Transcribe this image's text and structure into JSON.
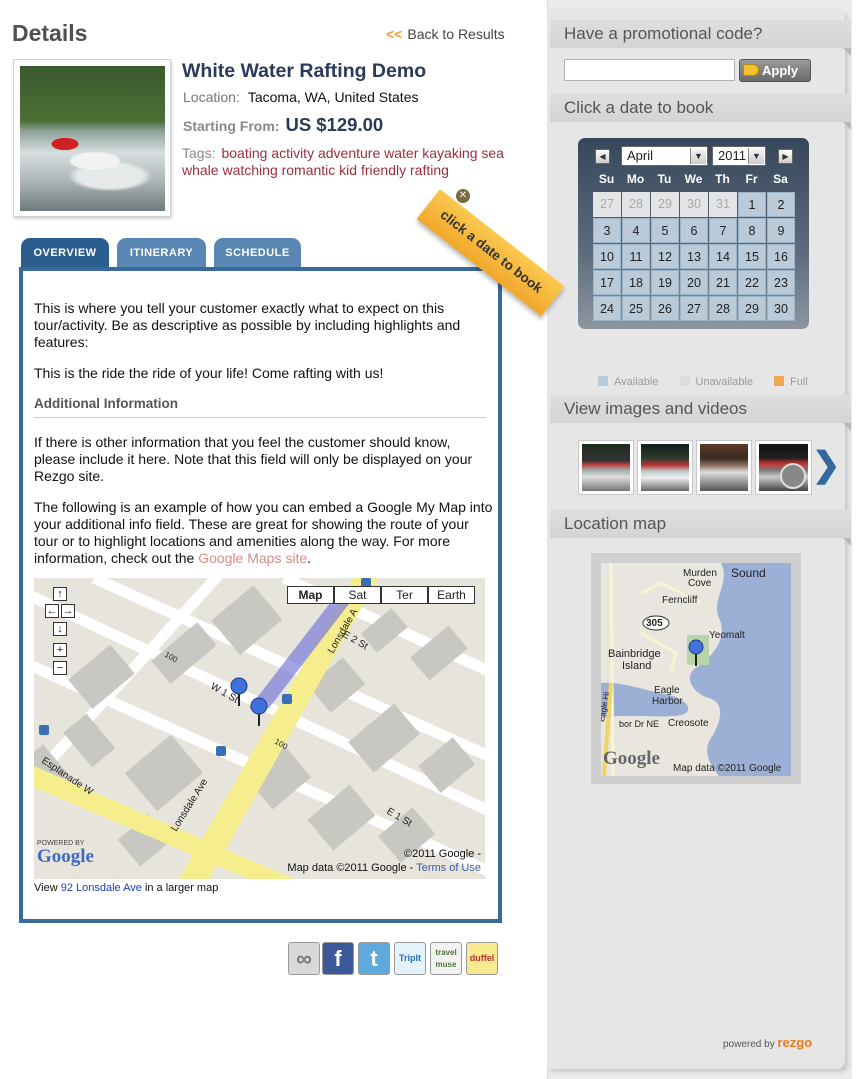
{
  "header": {
    "title": "Details",
    "back_arrows": "<<",
    "back_label": "Back to Results"
  },
  "tour": {
    "title": "White Water Rafting Demo",
    "location_label": "Location:",
    "location": "Tacoma, WA, United States",
    "price_label": "Starting From:",
    "price": "US $129.00",
    "tags_label": "Tags:",
    "tags": "boating activity adventure water kayaking sea whale watching romantic kid friendly rafting"
  },
  "tabs": [
    {
      "label": "OVERVIEW",
      "active": true
    },
    {
      "label": "ITINERARY",
      "active": false
    },
    {
      "label": "SCHEDULE",
      "active": false
    }
  ],
  "overview": {
    "p1": "This is where you tell your customer exactly what to expect on this tour/activity. Be as descriptive as possible by including highlights and features:",
    "p2": "This is the ride the ride of your life! Come rafting with us!",
    "additional_heading": "Additional Information",
    "p3": "If there is other information that you feel the customer should know, please include it here. Note that this field will only be displayed on your Rezgo site.",
    "p4": "The following is an example of how you can embed a Google My Map into your additional info field.  These are great for showing the route of your tour or to highlight locations and amenities along the way.  For more information, check out the",
    "p4_link": "Google Maps site",
    "p4_end": "."
  },
  "embed_map": {
    "types": [
      "Map",
      "Sat",
      "Ter",
      "Earth"
    ],
    "nav_glyphs": {
      "up": "↑",
      "left": "←",
      "right": "→",
      "down": "↓",
      "zoom_in": "+",
      "zoom_out": "−"
    },
    "streets": {
      "lonsdale_top": "Lonsdale A",
      "e2": "E 2 St",
      "w1": "W 1 St",
      "esplanade": "Esplanade W",
      "lonsdale_bottom": "Lonsdale Ave",
      "e1": "E 1 St",
      "hundred_a": "100",
      "hundred_b": "100"
    },
    "powered_by": "POWERED BY",
    "logo": "Google",
    "copyright1": "©2011 Google -",
    "copyright2": "Map data ©2011 Google -",
    "terms": "Terms of Use",
    "view_prefix": "View",
    "view_link": "92 Lonsdale Ave",
    "view_suffix": "in a larger map"
  },
  "social": [
    {
      "name": "link",
      "glyph": "∞",
      "bg": "#d8d8d8",
      "fg": "#777"
    },
    {
      "name": "facebook",
      "glyph": "f",
      "bg": "#3b5998",
      "fg": "#ffffff"
    },
    {
      "name": "twitter",
      "glyph": "t",
      "bg": "#5ea9dd",
      "fg": "#ffffff"
    },
    {
      "name": "tripit",
      "glyph": "TripIt",
      "bg": "#e4f2fb",
      "fg": "#2a70b8"
    },
    {
      "name": "travelmuse",
      "glyph": "travel muse",
      "bg": "#f2f2f2",
      "fg": "#4a7a32"
    },
    {
      "name": "duffel",
      "glyph": "duffel",
      "bg": "#f7e98f",
      "fg": "#b8332a"
    }
  ],
  "sidebar": {
    "promo_heading": "Have a promotional code?",
    "promo_value": "",
    "apply_label": "Apply",
    "book_heading": "Click a date to book",
    "ribbon": "click a date to book",
    "ribbon_close": "✕",
    "calendar": {
      "month": "April",
      "year": "2011",
      "prev_glyph": "◀",
      "next_glyph": "▶",
      "select_glyph": "▼",
      "weekdays": [
        "Su",
        "Mo",
        "Tu",
        "We",
        "Th",
        "Fr",
        "Sa"
      ],
      "weeks": [
        [
          [
            "27",
            "out"
          ],
          [
            "28",
            "out"
          ],
          [
            "29",
            "out"
          ],
          [
            "30",
            "out"
          ],
          [
            "31",
            "out"
          ],
          [
            "1",
            "avail"
          ],
          [
            "2",
            "avail"
          ]
        ],
        [
          [
            "3",
            "avail"
          ],
          [
            "4",
            "avail"
          ],
          [
            "5",
            "avail"
          ],
          [
            "6",
            "avail"
          ],
          [
            "7",
            "avail"
          ],
          [
            "8",
            "avail"
          ],
          [
            "9",
            "avail"
          ]
        ],
        [
          [
            "10",
            "avail"
          ],
          [
            "11",
            "avail"
          ],
          [
            "12",
            "avail"
          ],
          [
            "13",
            "avail"
          ],
          [
            "14",
            "avail"
          ],
          [
            "15",
            "avail"
          ],
          [
            "16",
            "avail"
          ]
        ],
        [
          [
            "17",
            "avail"
          ],
          [
            "18",
            "avail"
          ],
          [
            "19",
            "avail"
          ],
          [
            "20",
            "avail"
          ],
          [
            "21",
            "avail"
          ],
          [
            "22",
            "avail"
          ],
          [
            "23",
            "avail"
          ]
        ],
        [
          [
            "24",
            "avail"
          ],
          [
            "25",
            "avail"
          ],
          [
            "26",
            "avail"
          ],
          [
            "27",
            "avail"
          ],
          [
            "28",
            "avail"
          ],
          [
            "29",
            "avail"
          ],
          [
            "30",
            "avail"
          ]
        ]
      ]
    },
    "legend": [
      {
        "label": "Available",
        "color": "#b9cad8"
      },
      {
        "label": "Unavailable",
        "color": "#dcdcdc"
      },
      {
        "label": "Full",
        "color": "#f0a850"
      }
    ],
    "media_heading": "View images and videos",
    "media_next": "❯",
    "map_heading": "Location map",
    "location_map": {
      "labels": {
        "murden": "Murden",
        "cove": "Cove",
        "sound": "Sound",
        "ferncliff": "Ferncliff",
        "route": "305",
        "yeomalt": "Yeomalt",
        "bainbridge": "Bainbridge",
        "island": "Island",
        "eagle": "Eagle",
        "harbor": "Harbor",
        "ne": "bor Dr NE",
        "creosote": "Creosote",
        "hi": "Eagle Hi"
      },
      "logo": "Google",
      "copyright": "Map data ©2011 Google"
    },
    "powered_by": "powered by",
    "brand": "rezgo"
  }
}
